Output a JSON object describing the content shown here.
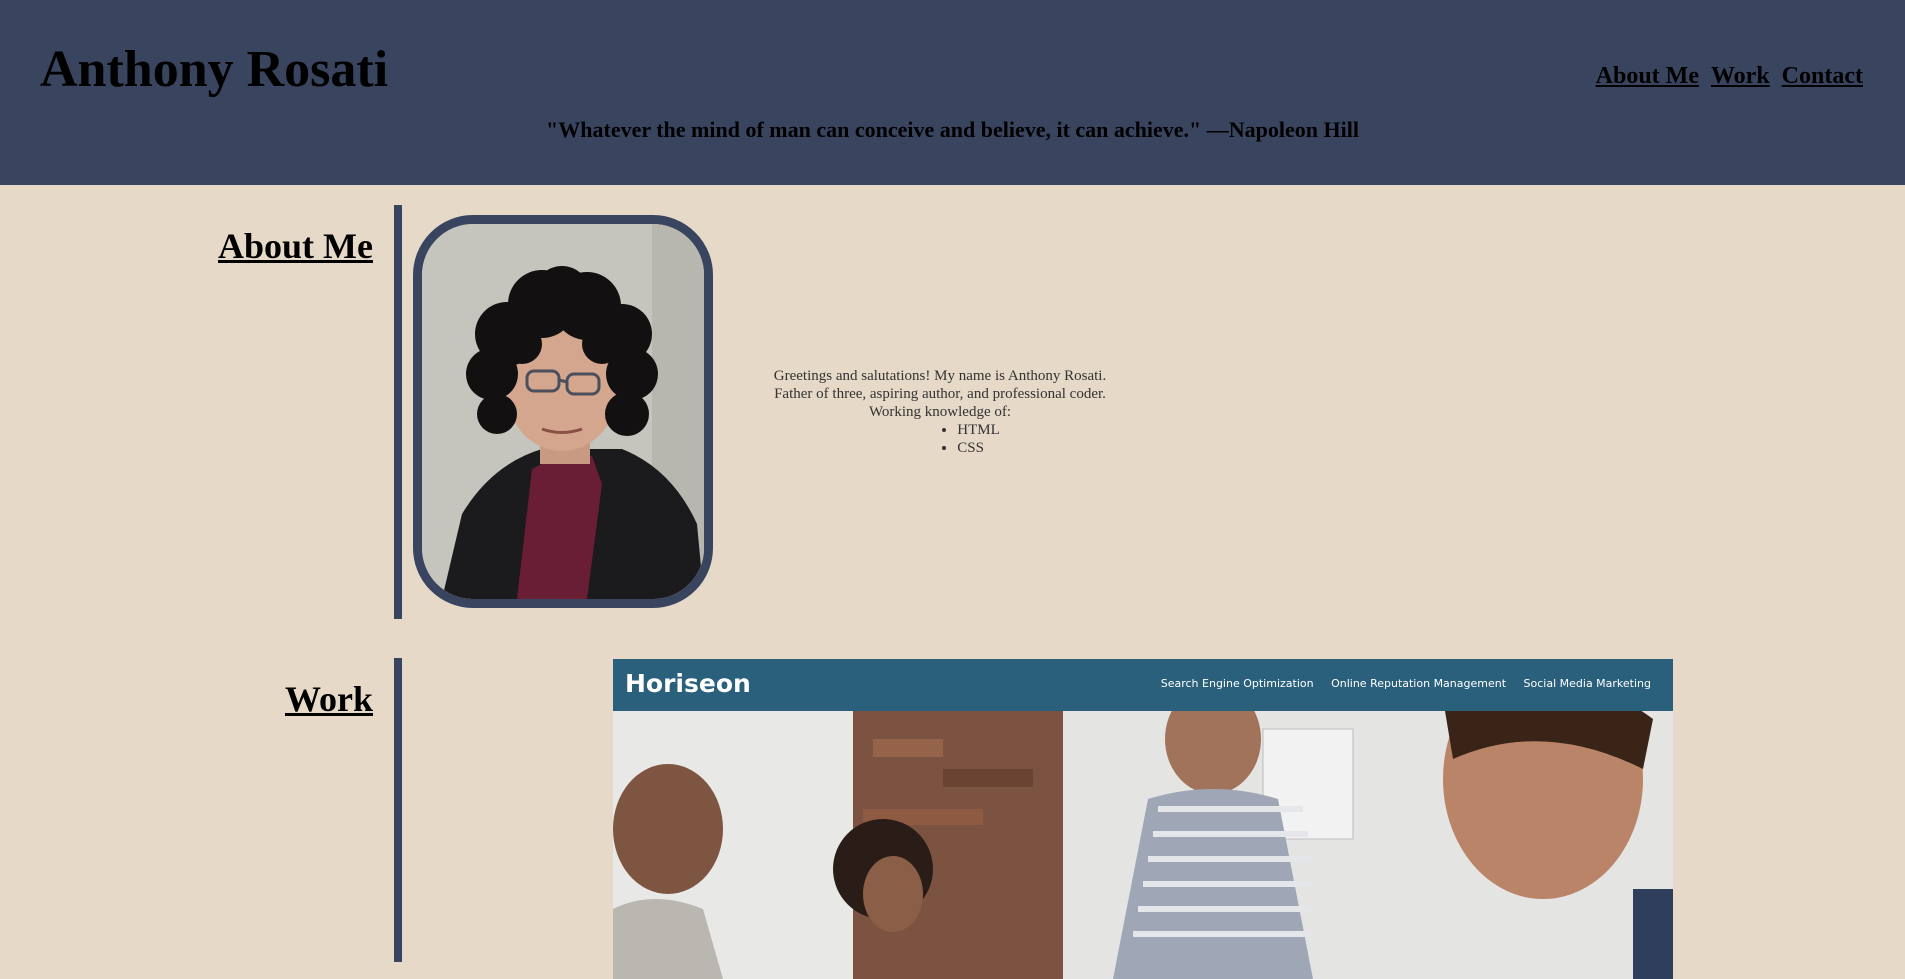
{
  "header": {
    "title": "Anthony Rosati",
    "quote": "\"Whatever the mind of man can conceive and believe, it can achieve.\" —Napoleon Hill",
    "nav": [
      {
        "label": "About Me"
      },
      {
        "label": "Work"
      },
      {
        "label": "Contact"
      }
    ]
  },
  "about": {
    "heading": "About Me",
    "intro_line1": "Greetings and salutations! My name is Anthony Rosati.",
    "intro_line2": "Father of three, aspiring author, and professional coder.",
    "intro_line3": "Working knowledge of:",
    "skills": [
      "HTML",
      "CSS"
    ]
  },
  "work": {
    "heading": "Work",
    "project": {
      "logo": "Horiseon",
      "nav": [
        "Search Engine Optimization",
        "Online Reputation Management",
        "Social Media Marketing"
      ]
    }
  },
  "colors": {
    "header_bg": "#39445f",
    "page_bg": "#e6d9c8",
    "horiseon_bar": "#2a607c"
  }
}
